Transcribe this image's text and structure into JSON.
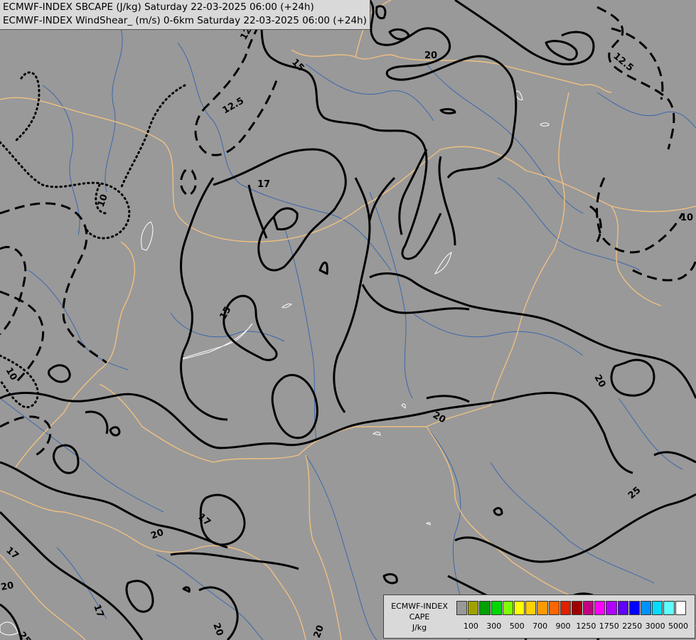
{
  "header": {
    "line1": "ECMWF-INDEX SBCAPE (J/kg) Saturday 22-03-2025 06:00 (+24h)",
    "line2": "ECMWF-INDEX WindShear_ (m/s) 0-6km Saturday 22-03-2025 06:00 (+24h)"
  },
  "legend": {
    "title_line1": "ECMWF-INDEX",
    "title_line2": "CAPE",
    "unit": "J/kg",
    "colors": [
      "#999999",
      "#a0a000",
      "#00a000",
      "#00d800",
      "#80ff00",
      "#ffff00",
      "#ffd000",
      "#ff9900",
      "#ff6600",
      "#e02000",
      "#a00000",
      "#c00080",
      "#ff00ff",
      "#b000ff",
      "#6000ff",
      "#0000ff",
      "#0090ff",
      "#00ddff",
      "#60ffff",
      "#ffffff"
    ],
    "ticks": [
      "100",
      "300",
      "500",
      "700",
      "900",
      "1250",
      "1750",
      "2250",
      "3000",
      "5000"
    ]
  },
  "contour_labels": [
    "15",
    "12.5",
    "20",
    "12.5",
    "12.5",
    "10",
    "17",
    "15",
    "10",
    "20",
    "20",
    "25",
    "17",
    "20",
    "17",
    "20",
    "17",
    "20",
    "25",
    "20",
    "10"
  ],
  "map_colors": {
    "background": "#999999",
    "borders": "#f0c080",
    "rivers": "#2b5fb0",
    "contours": "#000000",
    "cape_outline": "#ffffff"
  }
}
